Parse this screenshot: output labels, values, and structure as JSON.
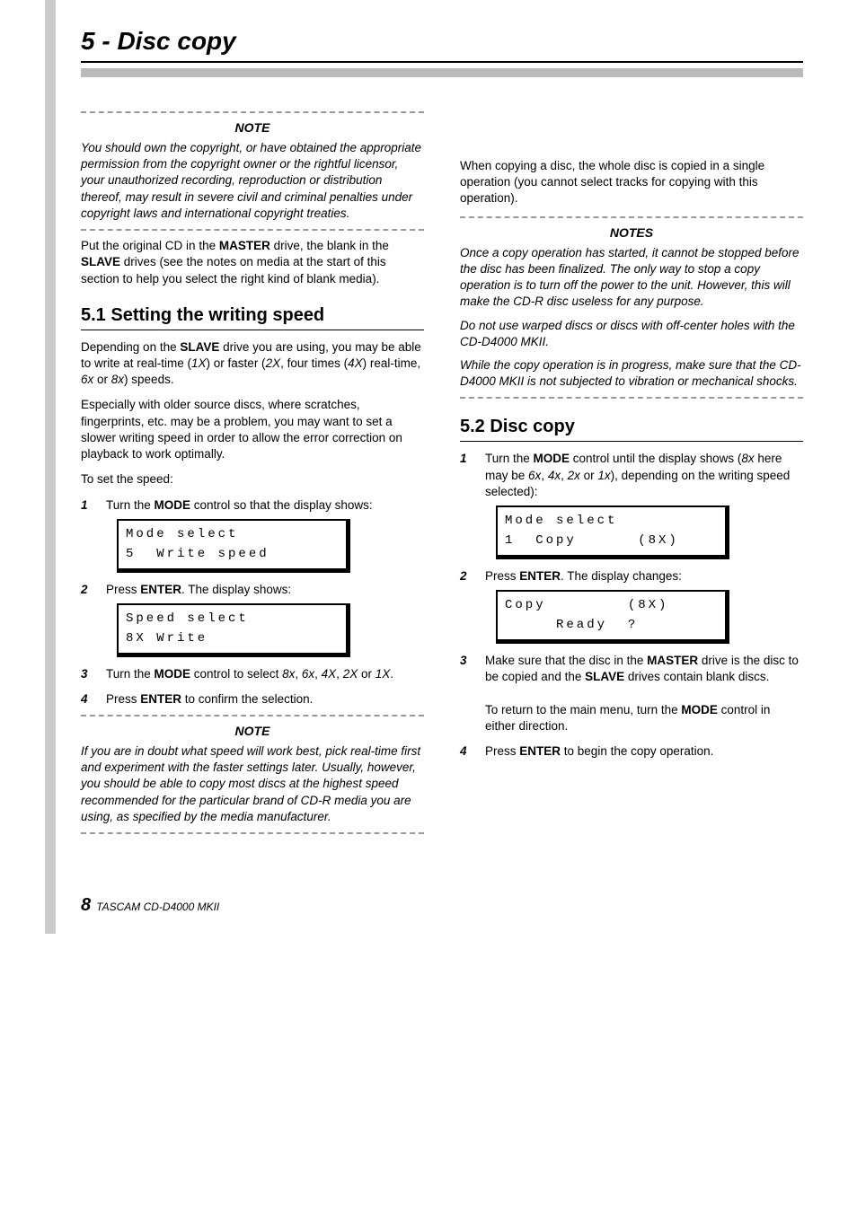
{
  "chapter_title": "5 - Disc copy",
  "left": {
    "note1_head": "NOTE",
    "note1_body": "You should own the copyright, or have obtained the appropriate permission from the copyright owner or the rightful licensor, your unauthorized recording, reproduction or distribution thereof, may result in severe civil and criminal penalties under copyright laws and international copyright treaties.",
    "after_note_span1": "Put the original CD in the ",
    "after_note_b1": "MASTER",
    "after_note_span2": " drive, the blank in the ",
    "after_note_b2": "SLAVE",
    "after_note_span3": " drives (see the notes on media at the start of this section to help you select the right kind of blank media).",
    "sec51_head": "5.1  Setting the writing speed",
    "sec51_p1_a": "Depending on the ",
    "sec51_p1_b": "SLAVE",
    "sec51_p1_c": " drive you are using, you may be able to write at real-time (",
    "sec51_p1_d": "1X",
    "sec51_p1_e": ") or faster (",
    "sec51_p1_f": "2X",
    "sec51_p1_g": ", four times (",
    "sec51_p1_h": "4X",
    "sec51_p1_i": ") real-time, ",
    "sec51_p1_j": "6x",
    "sec51_p1_k": " or ",
    "sec51_p1_l": "8x",
    "sec51_p1_m": ") speeds.",
    "sec51_p2": "Especially with older source discs, where scratches, fingerprints, etc. may be a problem, you may want to set a slower writing speed in order to allow the error correction on playback to work optimally.",
    "sec51_p3": "To set the speed:",
    "sec51_s1_a": "Turn the ",
    "sec51_s1_b": "MODE",
    "sec51_s1_c": " control so that the display shows:",
    "lcd1": "Mode select\n5  Write speed",
    "sec51_s2_a": "Press ",
    "sec51_s2_b": "ENTER",
    "sec51_s2_c": ". The display shows:",
    "lcd2": "Speed select\n8X Write",
    "sec51_s3_a": "Turn the ",
    "sec51_s3_b": "MODE",
    "sec51_s3_c": " control to select ",
    "sec51_s3_d": "8x",
    "sec51_s3_e": ", ",
    "sec51_s3_f": "6x",
    "sec51_s3_g": ", ",
    "sec51_s3_h": "4X",
    "sec51_s3_i": ", ",
    "sec51_s3_j": "2X",
    "sec51_s3_k": " or ",
    "sec51_s3_l": "1X",
    "sec51_s3_m": ".",
    "sec51_s4_a": "Press ",
    "sec51_s4_b": "ENTER",
    "sec51_s4_c": " to confirm the selection.",
    "note2_head": "NOTE",
    "note2_body": "If you are in doubt what speed will work best, pick real-time first and experiment with the faster settings later. Usually, however, you should be able to copy most discs at the highest speed recommended for the particular brand of CD-R media you are using, as specified by the media manufacturer."
  },
  "right": {
    "pre_note": "When copying a disc, the whole disc is copied in a single operation (you cannot select tracks for copying with this operation).",
    "notes_head": "NOTES",
    "notes_p1": "Once a copy operation has started, it cannot be stopped before the disc has been finalized. The only way to stop a copy operation is to turn off the power to the unit. However, this will make the CD-R disc useless for any purpose.",
    "notes_p2": "Do not use warped discs or discs with off-center holes with the CD-D4000 MKII.",
    "notes_p3": "While the copy operation is in progress, make sure that the CD-D4000 MKII is not subjected to vibration or mechanical shocks.",
    "sec52_head": "5.2  Disc copy",
    "sec52_s1_a": "Turn the ",
    "sec52_s1_b": "MODE",
    "sec52_s1_c": " control until the display shows (",
    "sec52_s1_d": "8x",
    "sec52_s1_e": " here may be ",
    "sec52_s1_f": "6x",
    "sec52_s1_g": ", ",
    "sec52_s1_h": "4x",
    "sec52_s1_i": ", ",
    "sec52_s1_j": "2x",
    "sec52_s1_k": " or ",
    "sec52_s1_l": "1x",
    "sec52_s1_m": "), depending on the writing speed selected):",
    "lcd3": "Mode select\n1  Copy      (8X)",
    "sec52_s2_a": "Press ",
    "sec52_s2_b": "ENTER",
    "sec52_s2_c": ". The display changes:",
    "lcd4": "Copy        (8X)\n     Ready  ?",
    "sec52_s3_a": "Make sure that the disc in the ",
    "sec52_s3_b": "MASTER",
    "sec52_s3_c": " drive is the disc to be copied and the ",
    "sec52_s3_d": "SLAVE",
    "sec52_s3_e": " drives contain blank discs.",
    "sec52_s3_f": "To return to the main menu, turn the ",
    "sec52_s3_g": "MODE",
    "sec52_s3_h": " control in either direction.",
    "sec52_s4_a": "Press ",
    "sec52_s4_b": "ENTER",
    "sec52_s4_c": " to begin the copy operation."
  },
  "footer": {
    "page": "8",
    "label": "TASCAM CD-D4000 MKII"
  }
}
